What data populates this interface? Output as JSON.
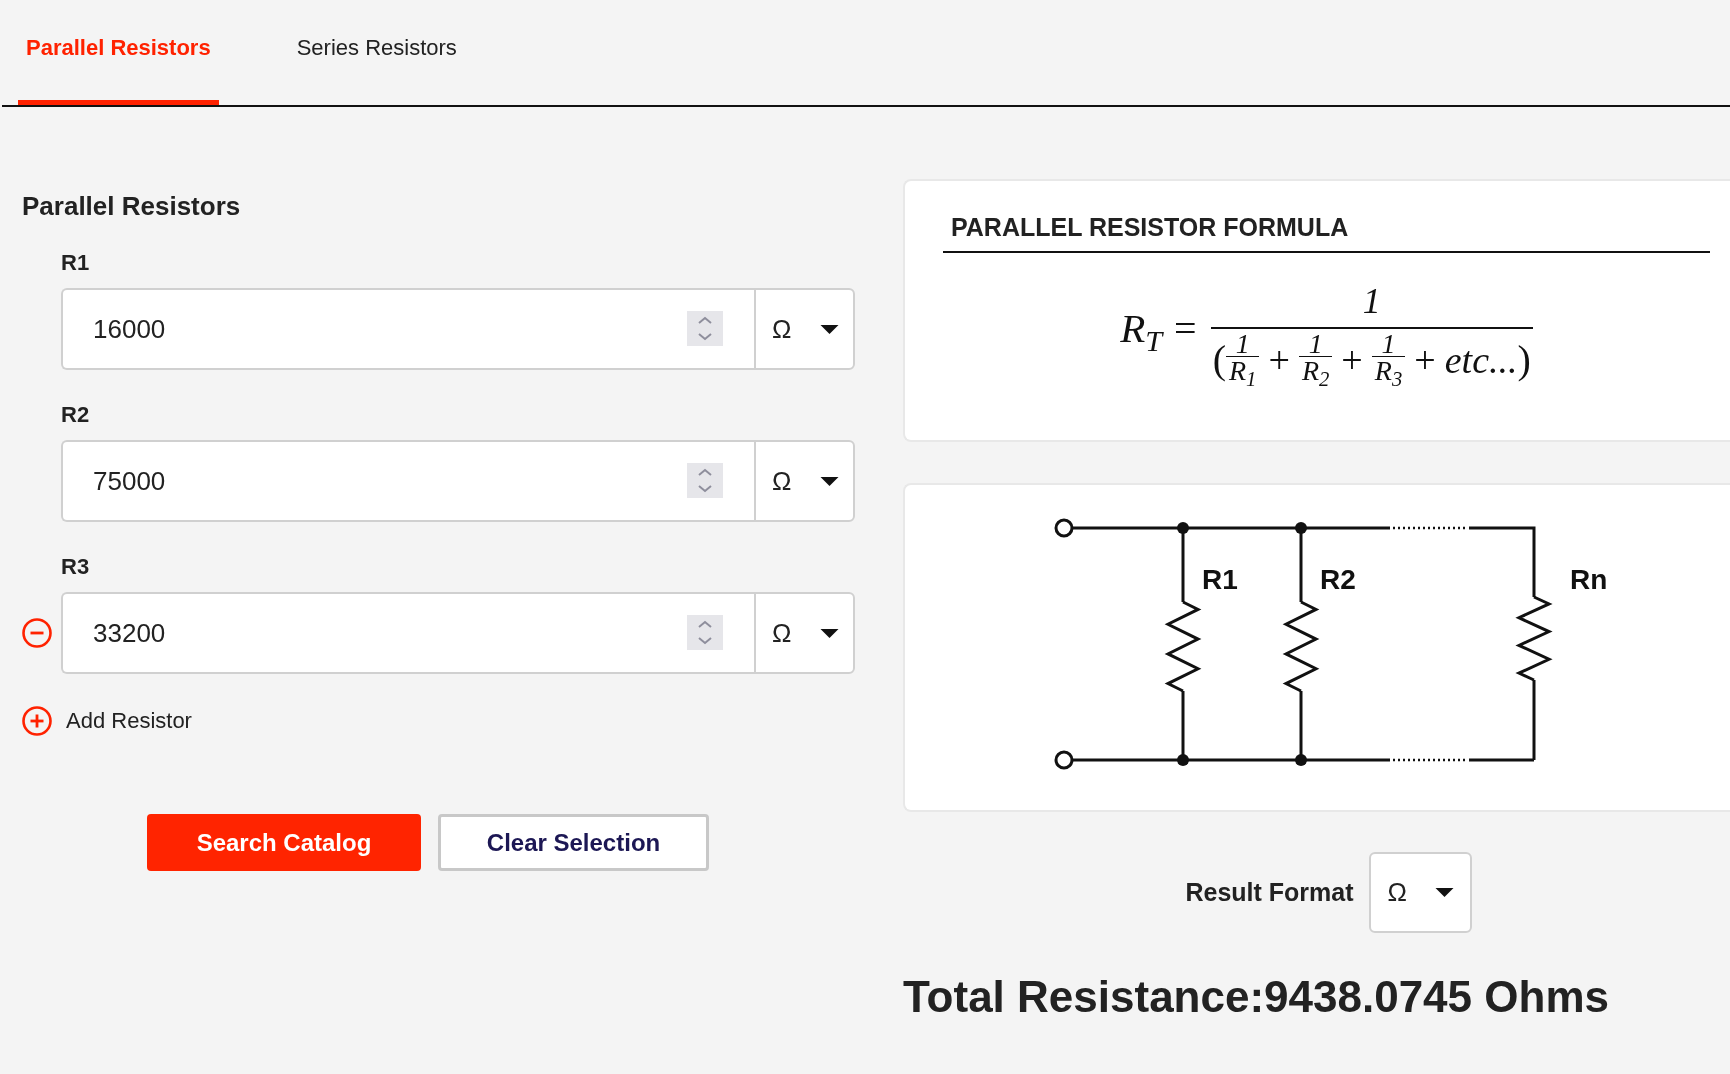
{
  "tabs": [
    {
      "label": "Parallel Resistors",
      "selected": true
    },
    {
      "label": "Series Resistors",
      "selected": false
    }
  ],
  "section_title": "Parallel Resistors",
  "resistors": [
    {
      "label": "R1",
      "value": "16000",
      "unit": "Ω",
      "removable": false
    },
    {
      "label": "R2",
      "value": "75000",
      "unit": "Ω",
      "removable": false
    },
    {
      "label": "R3",
      "value": "33200",
      "unit": "Ω",
      "removable": true
    }
  ],
  "add_button": "Add Resistor",
  "buttons": [
    {
      "label": "Search Catalog",
      "kind": "primary"
    },
    {
      "label": "Clear Selection",
      "kind": "secondary"
    }
  ],
  "formula_card": {
    "title": "PARALLEL RESISTOR FORMULA",
    "lhs": "R$_{T}$",
    "relation": "=",
    "numerator": "1",
    "denominator": [
      {
        "kind": "paren",
        "text": "("
      },
      {
        "kind": "fraction",
        "numerator": "1",
        "denominator": "R$_{1}$"
      },
      {
        "kind": "operator",
        "text": "+"
      },
      {
        "kind": "fraction",
        "numerator": "1",
        "denominator": "R$_{2}$"
      },
      {
        "kind": "operator",
        "text": "+"
      },
      {
        "kind": "fraction",
        "numerator": "1",
        "denominator": "R$_{3}$"
      },
      {
        "kind": "operator",
        "text": "+"
      },
      {
        "kind": "term",
        "text": "etc..."
      },
      {
        "kind": "paren",
        "text": ")"
      }
    ]
  },
  "circuit": {
    "resistors": [
      "R1",
      "R2",
      "Rn"
    ]
  },
  "result_format": {
    "label": "Result Format",
    "unit": "Ω"
  },
  "total_resistance": "Total Resistance:9438.0745 Ohms"
}
